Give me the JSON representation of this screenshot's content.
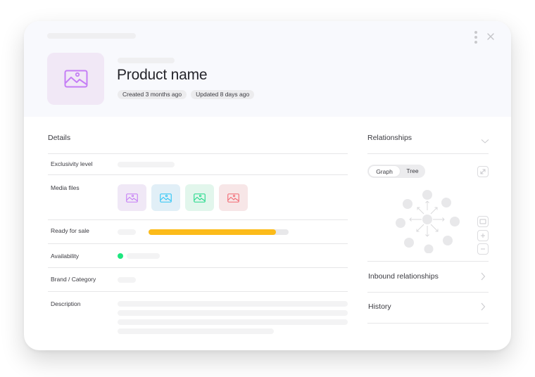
{
  "header": {
    "title": "Product name",
    "badges": [
      "Created 3 months ago",
      "Updated 8 days ago"
    ],
    "thumbnail_icon": "image-icon",
    "menu_icon": "kebab-menu-icon",
    "close_icon": "close-icon"
  },
  "details": {
    "title": "Details",
    "rows": [
      {
        "label": "Exclusivity level"
      },
      {
        "label": "Media files"
      },
      {
        "label": "Ready for sale",
        "progress_percent": 91
      },
      {
        "label": "Availability",
        "status_color": "#1ee67f"
      },
      {
        "label": "Brand / Category"
      },
      {
        "label": "Description"
      }
    ],
    "media_files": [
      {
        "icon": "image-icon",
        "bg": "#f0e8f6",
        "color": "#c57ef5"
      },
      {
        "icon": "image-icon",
        "bg": "#e1eff7",
        "color": "#2ec5f5"
      },
      {
        "icon": "image-icon",
        "bg": "#e2f6ec",
        "color": "#22d98a"
      },
      {
        "icon": "image-icon",
        "bg": "#f7e6e7",
        "color": "#f26a74"
      }
    ],
    "progress_color": "#fcbb1a"
  },
  "relationships": {
    "title": "Relationships",
    "view_toggle": {
      "options": [
        "Graph",
        "Tree"
      ],
      "selected": "Graph"
    },
    "graph_controls": [
      "expand-icon",
      "fit-screen-icon",
      "zoom-in-icon",
      "zoom-out-icon"
    ],
    "items": [
      {
        "label": "Inbound relationships"
      },
      {
        "label": "History"
      }
    ]
  }
}
